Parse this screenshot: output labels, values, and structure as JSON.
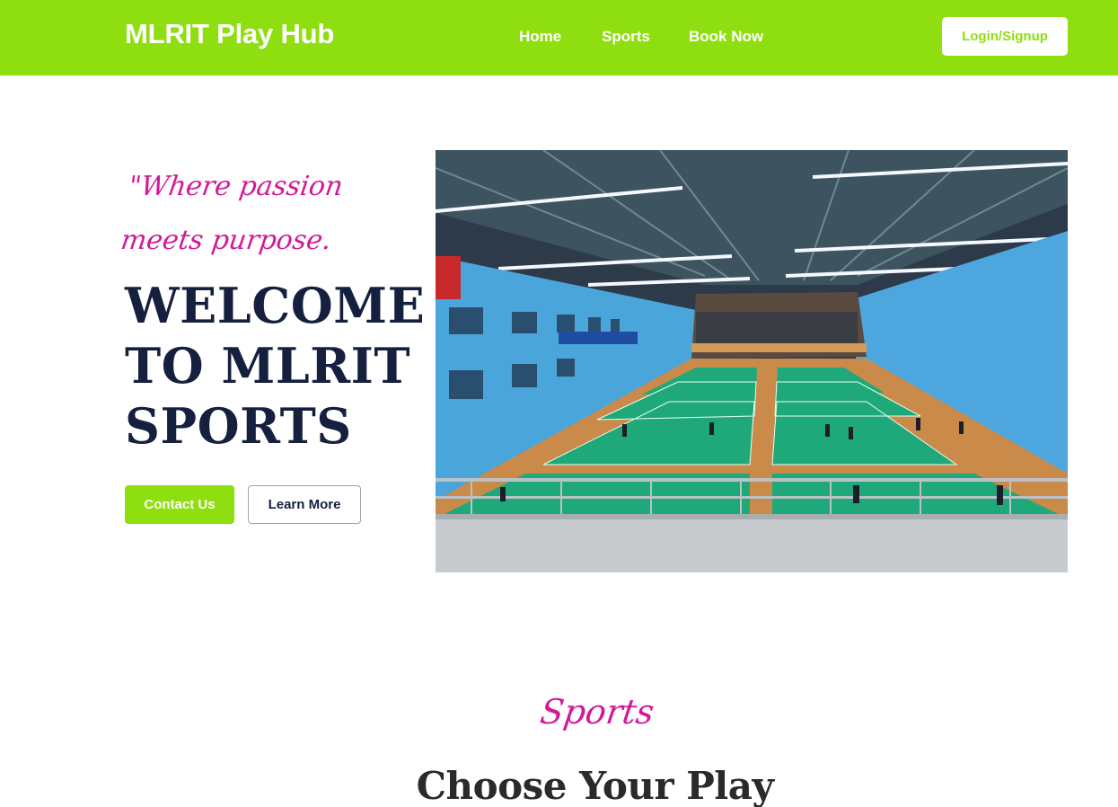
{
  "header": {
    "brand": "MLRIT Play Hub",
    "nav": [
      {
        "label": "Home"
      },
      {
        "label": "Sports"
      },
      {
        "label": "Book Now"
      }
    ],
    "login_label": "Login/Signup"
  },
  "hero": {
    "tagline": "\"Where passion meets purpose.",
    "title": "WELCOME TO MLRIT SPORTS",
    "contact_label": "Contact Us",
    "learn_label": "Learn More",
    "image_alt": "Indoor badminton courts"
  },
  "sports_section": {
    "script_heading": "Sports",
    "title": "Choose Your Play"
  },
  "colors": {
    "accent": "#8fde10",
    "script_pink": "#d21a99",
    "navy": "#15203f"
  }
}
